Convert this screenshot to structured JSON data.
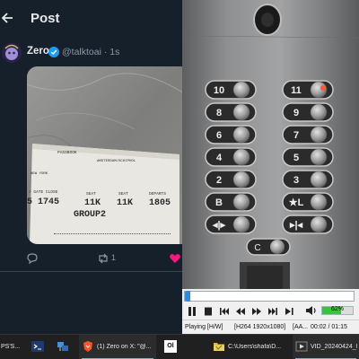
{
  "twitter": {
    "header_title": "Post",
    "author_name": "Zero",
    "author_handle": "@talktoai",
    "separator": " · ",
    "post_age": "1s",
    "repost_count": "1",
    "colors": {
      "background": "#15202b",
      "like": "#f91880",
      "verified": "#1d9bf0"
    },
    "icons": {
      "back": "arrow-left",
      "reply": "speech-bubble",
      "repost": "repost-arrows",
      "like": "heart"
    }
  },
  "boarding_pass": {
    "airline_row": "PASSBOOK",
    "row1": "AMSTERDAM/SCHIPHOL",
    "row2": "NEW YORK",
    "gate_close_label": "/ GATE CLOSE",
    "gate_close_value": "5  1745",
    "group": "GROUP2",
    "seat_label": "SEAT",
    "seat_value": "11K",
    "seat2_label": "SEAT",
    "seat2_value": "11K",
    "departs_label": "DEPARTS",
    "departs_value": "1805"
  },
  "elevator_panel": {
    "buttons": [
      {
        "left": "10",
        "right": "11",
        "lit": "right"
      },
      {
        "left": "8",
        "right": "9"
      },
      {
        "left": "6",
        "right": "7"
      },
      {
        "left": "4",
        "right": "5"
      },
      {
        "left": "2",
        "right": "3"
      },
      {
        "left": "B",
        "right": "★L"
      },
      {
        "left": "◂|▸",
        "right": "▸|◂"
      }
    ],
    "bottom_button": "C"
  },
  "player": {
    "state": "Playing [H/W]",
    "codec": "[H264 1920x1080]",
    "audio": "[AA...",
    "time": "00:02 / 01:15",
    "volume_label": "62%",
    "volume": 0.62,
    "progress": 0.027,
    "colors": {
      "seek": "#3a8fd8",
      "volume": "#39c23b"
    }
  },
  "taskbar": {
    "items": [
      {
        "label": "PS'S...",
        "icon": "app-icon"
      },
      {
        "label": "",
        "icon": "terminal-icon"
      },
      {
        "label": "",
        "icon": "network-icon"
      },
      {
        "label": "(1) Zero on X: \"@...",
        "icon": "brave-icon"
      },
      {
        "label": "",
        "icon": "ol-icon",
        "text": "Ol"
      },
      {
        "label": "C:\\Users\\shafa\\D...",
        "icon": "folder-icon"
      },
      {
        "label": "VID_20240424_0...",
        "icon": "video-icon"
      }
    ]
  }
}
